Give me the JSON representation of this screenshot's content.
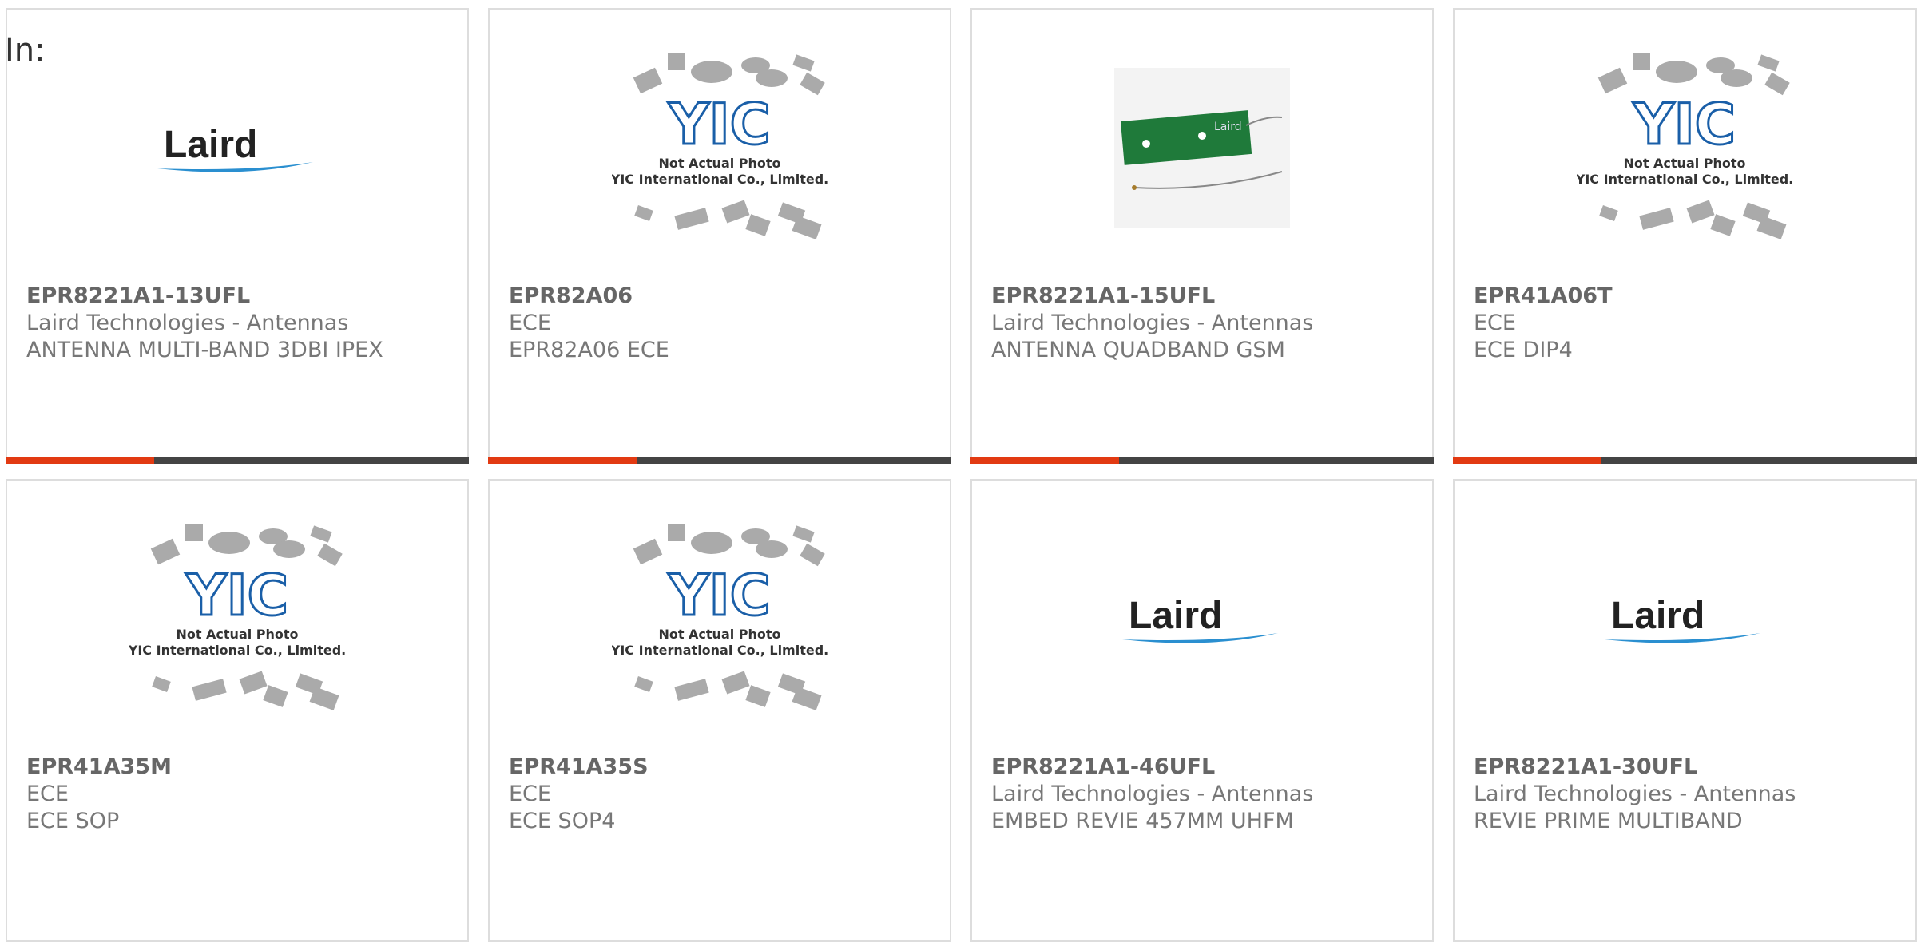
{
  "header": {
    "in_label": "In:"
  },
  "products": [
    {
      "part_number": "EPR8221A1-13UFL",
      "manufacturer": "Laird Technologies - Antennas",
      "description": "ANTENNA MULTI-BAND 3DBI IPEX",
      "image": "laird-logo"
    },
    {
      "part_number": "EPR82A06",
      "manufacturer": "ECE",
      "description": "EPR82A06 ECE",
      "image": "yic-placeholder"
    },
    {
      "part_number": "EPR8221A1-15UFL",
      "manufacturer": "Laird Technologies - Antennas",
      "description": "ANTENNA QUADBAND GSM",
      "image": "antenna-pcb-photo"
    },
    {
      "part_number": "EPR41A06T",
      "manufacturer": "ECE",
      "description": "ECE DIP4",
      "image": "yic-placeholder"
    },
    {
      "part_number": "EPR41A35M",
      "manufacturer": "ECE",
      "description": "ECE SOP",
      "image": "yic-placeholder"
    },
    {
      "part_number": "EPR41A35S",
      "manufacturer": "ECE",
      "description": "ECE SOP4",
      "image": "yic-placeholder"
    },
    {
      "part_number": "EPR8221A1-46UFL",
      "manufacturer": "Laird Technologies - Antennas",
      "description": "EMBED REVIE 457MM UHFM",
      "image": "laird-logo"
    },
    {
      "part_number": "EPR8221A1-30UFL",
      "manufacturer": "Laird Technologies - Antennas",
      "description": "REVIE PRIME MULTIBAND",
      "image": "laird-logo"
    }
  ],
  "logos": {
    "laird": "Laird",
    "yic": "YIC"
  },
  "placeholder": {
    "line1": "Not Actual Photo",
    "line2": "YIC International Co., Limited."
  },
  "pcb_label": "Laird",
  "colors": {
    "accent": "#e23a12",
    "bar": "#444444",
    "laird_blue": "#2a8fd0",
    "yic_blue": "#1a5fa8",
    "pcb_green": "#1f7a3a"
  }
}
